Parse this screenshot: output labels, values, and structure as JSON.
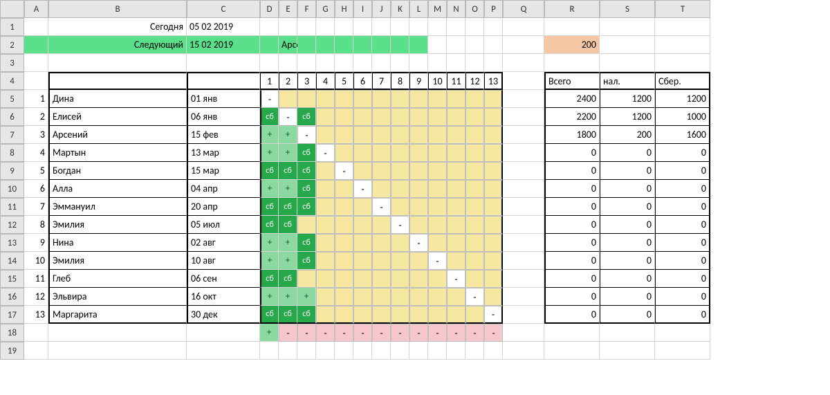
{
  "columns": [
    "",
    "A",
    "B",
    "C",
    "D",
    "E",
    "F",
    "G",
    "H",
    "I",
    "J",
    "K",
    "L",
    "M",
    "N",
    "O",
    "P",
    "Q",
    "R",
    "S",
    "T"
  ],
  "rows": [
    "1",
    "2",
    "3",
    "4",
    "5",
    "6",
    "7",
    "8",
    "9",
    "10",
    "11",
    "12",
    "13",
    "14",
    "15",
    "16",
    "17",
    "18",
    "19"
  ],
  "row1": {
    "today_label": "Сегодня",
    "today_val": "05 02 2019"
  },
  "row2": {
    "next_label": "Следующий",
    "next_val": "15 02 2019",
    "name": "Арсений",
    "amount": "200"
  },
  "header_nums": [
    "1",
    "2",
    "3",
    "4",
    "5",
    "6",
    "7",
    "8",
    "9",
    "10",
    "11",
    "12",
    "13"
  ],
  "people": [
    {
      "n": "1",
      "name": "Дина",
      "date": "01 янв",
      "marks": [
        "-",
        "",
        "",
        "",
        "",
        "",
        "",
        "",
        "",
        "",
        "",
        "",
        ""
      ],
      "r": "2400",
      "s": "1200",
      "t": "1200",
      "white": 0
    },
    {
      "n": "2",
      "name": "Елисей",
      "date": "06 янв",
      "marks": [
        "сб",
        "-",
        "сб",
        "",
        "",
        "",
        "",
        "",
        "",
        "",
        "",
        "",
        ""
      ],
      "r": "2200",
      "s": "1200",
      "t": "1000",
      "white": 1
    },
    {
      "n": "3",
      "name": "Арсений",
      "date": "15 фев",
      "marks": [
        "+",
        "+",
        "-",
        "",
        "",
        "",
        "",
        "",
        "",
        "",
        "",
        "",
        ""
      ],
      "r": "1800",
      "s": "200",
      "t": "1600",
      "white": 2
    },
    {
      "n": "4",
      "name": "Мартын",
      "date": "13 мар",
      "marks": [
        "+",
        "+",
        "сб",
        "-",
        "",
        "",
        "",
        "",
        "",
        "",
        "",
        "",
        ""
      ],
      "r": "0",
      "s": "0",
      "t": "0",
      "white": 3
    },
    {
      "n": "5",
      "name": "Богдан",
      "date": "15 мар",
      "marks": [
        "сб",
        "сб",
        "сб",
        "",
        "-",
        "",
        "",
        "",
        "",
        "",
        "",
        "",
        ""
      ],
      "r": "0",
      "s": "0",
      "t": "0",
      "white": 4
    },
    {
      "n": "6",
      "name": "Алла",
      "date": "04 апр",
      "marks": [
        "+",
        "+",
        "сб",
        "",
        "",
        "-",
        "",
        "",
        "",
        "",
        "",
        "",
        ""
      ],
      "r": "0",
      "s": "0",
      "t": "0",
      "white": 5
    },
    {
      "n": "7",
      "name": "Эммануил",
      "date": "20 апр",
      "marks": [
        "сб",
        "сб",
        "сб",
        "",
        "",
        "",
        "-",
        "",
        "",
        "",
        "",
        "",
        ""
      ],
      "r": "0",
      "s": "0",
      "t": "0",
      "white": 6
    },
    {
      "n": "8",
      "name": "Эмилия",
      "date": "05 июл",
      "marks": [
        "сб",
        "сб",
        "",
        "",
        "",
        "",
        "",
        "-",
        "",
        "",
        "",
        "",
        ""
      ],
      "r": "0",
      "s": "0",
      "t": "0",
      "white": 7
    },
    {
      "n": "9",
      "name": "Нина",
      "date": "02 авг",
      "marks": [
        "+",
        "+",
        "сб",
        "",
        "",
        "",
        "",
        "",
        "-",
        "",
        "",
        "",
        ""
      ],
      "r": "0",
      "s": "0",
      "t": "0",
      "white": 8
    },
    {
      "n": "10",
      "name": "Эмилия",
      "date": "10 авг",
      "marks": [
        "+",
        "+",
        "сб",
        "",
        "",
        "",
        "",
        "",
        "",
        "-",
        "",
        "",
        ""
      ],
      "r": "0",
      "s": "0",
      "t": "0",
      "white": 9
    },
    {
      "n": "11",
      "name": "Глеб",
      "date": "06 сен",
      "marks": [
        "сб",
        "сб",
        "",
        "",
        "",
        "",
        "",
        "",
        "",
        "",
        "-",
        "",
        ""
      ],
      "r": "0",
      "s": "0",
      "t": "0",
      "white": 10
    },
    {
      "n": "12",
      "name": "Эльвира",
      "date": "16 окт",
      "marks": [
        "+",
        "+",
        "+",
        "",
        "",
        "",
        "",
        "",
        "",
        "",
        "",
        "-",
        ""
      ],
      "r": "0",
      "s": "0",
      "t": "0",
      "white": 11
    },
    {
      "n": "13",
      "name": "Маргарита",
      "date": "30 дек",
      "marks": [
        "сб",
        "сб",
        "сб",
        "",
        "",
        "",
        "",
        "",
        "",
        "",
        "",
        "",
        "-"
      ],
      "r": "0",
      "s": "0",
      "t": "0",
      "white": 12
    }
  ],
  "totals_hdr": {
    "r": "Всего",
    "s": "нал.",
    "t": "Сбер."
  },
  "row18_marks": [
    "+",
    "-",
    "-",
    "-",
    "-",
    "-",
    "-",
    "-",
    "-",
    "-",
    "-",
    "-",
    "-"
  ]
}
